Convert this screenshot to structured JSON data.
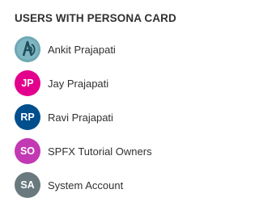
{
  "section": {
    "title": "USERS WITH PERSONA CARD"
  },
  "personas": [
    {
      "name": "Ankit Prajapati",
      "initials": "",
      "avatar": "photo-icon",
      "color": "#5a9aa8"
    },
    {
      "name": "Jay Prajapati",
      "initials": "JP",
      "avatar": "initials",
      "color": "#e3008c"
    },
    {
      "name": "Ravi Prajapati",
      "initials": "RP",
      "avatar": "initials",
      "color": "#004e8c"
    },
    {
      "name": "SPFX Tutorial Owners",
      "initials": "SO",
      "avatar": "initials",
      "color": "#c239b3"
    },
    {
      "name": "System Account",
      "initials": "SA",
      "avatar": "initials",
      "color": "#69797e"
    }
  ]
}
